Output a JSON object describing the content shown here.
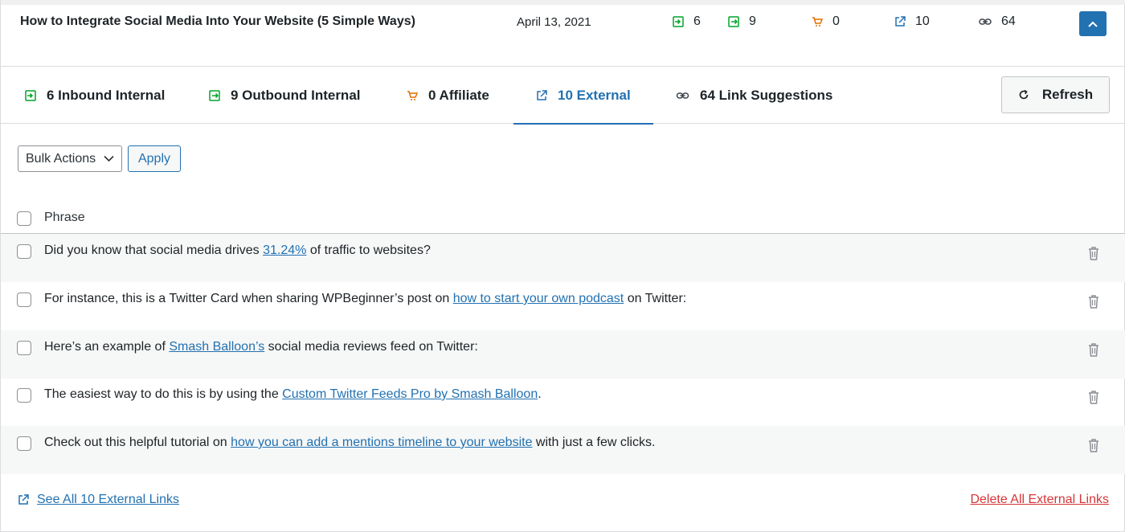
{
  "colors": {
    "accent": "#2271b1",
    "inbound": "#00a32a",
    "outbound": "#00a32a",
    "affiliate": "#dba617",
    "danger": "#d63638"
  },
  "summary": {
    "post_title": "How to Integrate Social Media Into Your Website (5 Simple Ways)",
    "date": "April 13, 2021",
    "stats": {
      "inbound_internal": "6",
      "outbound_internal": "9",
      "affiliate": "0",
      "external": "10",
      "link_suggestions": "64"
    },
    "collapse_icon": "chevron-up-icon"
  },
  "tabs": [
    {
      "label": "6 Inbound Internal",
      "icon": "inbound-link-icon",
      "active": false
    },
    {
      "label": "9 Outbound Internal",
      "icon": "outbound-link-icon",
      "active": false
    },
    {
      "label": "0 Affiliate",
      "icon": "cart-icon",
      "active": false
    },
    {
      "label": "10 External",
      "icon": "external-link-icon",
      "active": true
    },
    {
      "label": "64 Link Suggestions",
      "icon": "chain-link-icon",
      "active": false
    }
  ],
  "refresh_label": "Refresh",
  "bulk": {
    "selected": "Bulk Actions",
    "apply_label": "Apply"
  },
  "table": {
    "column_header": "Phrase",
    "rows": [
      {
        "before": "Did you know that social media drives ",
        "link": "31.24%",
        "after": " of traffic to websites?"
      },
      {
        "before": "For instance, this is a Twitter Card when sharing WPBeginner’s post on ",
        "link": "how to start your own podcast",
        "after": " on Twitter:"
      },
      {
        "before": "Here’s an example of ",
        "link": "Smash Balloon’s",
        "after": " social media reviews feed on Twitter:"
      },
      {
        "before": "The easiest way to do this is by using the ",
        "link": "Custom Twitter Feeds Pro by Smash Balloon",
        "after": "."
      },
      {
        "before": "Check out this helpful tutorial on ",
        "link": "how you can add a mentions timeline to your website",
        "after": " with just a few clicks."
      }
    ]
  },
  "footer": {
    "see_all_label": "See All 10 External Links",
    "delete_all_label": "Delete All External Links"
  }
}
